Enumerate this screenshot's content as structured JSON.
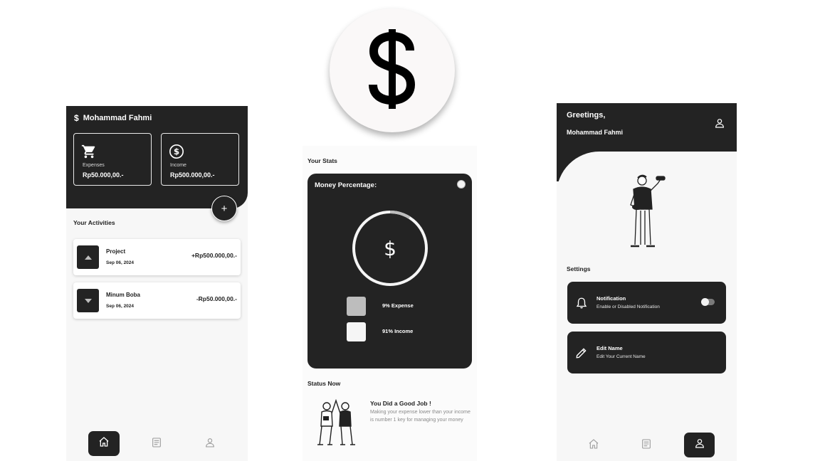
{
  "logo": {
    "icon": "dollar-icon",
    "symbol": "$"
  },
  "home": {
    "title": "Mohammad Fahmi",
    "cards": [
      {
        "icon": "cart-icon",
        "label": "Expenses",
        "value": "Rp50.000,00.-"
      },
      {
        "icon": "dollar-circle-icon",
        "label": "Income",
        "value": "Rp500.000,00.-"
      }
    ],
    "add_label": "+",
    "activities_heading": "Your Activities",
    "activities": [
      {
        "name": "Project",
        "date": "Sep 06, 2024",
        "amount": "+Rp500.000,00.-",
        "direction": "up"
      },
      {
        "name": "Minum Boba",
        "date": "Sep 06, 2024",
        "amount": "-Rp50.000,00.-",
        "direction": "down"
      }
    ],
    "nav": [
      "home",
      "list",
      "profile"
    ],
    "nav_active": "home"
  },
  "stats": {
    "heading": "Your Stats",
    "card_title": "Money Percentage:",
    "ring_symbol": "$",
    "expense_percent": 9,
    "legend": [
      {
        "label": "9% Expense",
        "color": "#bdbdbd"
      },
      {
        "label": "91% Income",
        "color": "#f5f5f5"
      }
    ],
    "status_heading": "Status Now",
    "status_title": "You Did a Good Job !",
    "status_text": "Making your expense lower than your income is number 1 key for managing your money"
  },
  "profile": {
    "greeting": "Greetings,",
    "name": "Mohammad Fahmi",
    "settings_heading": "Settings",
    "settings": [
      {
        "icon": "bell-icon",
        "title": "Notification",
        "subtitle": "Enable or Disabled Notification",
        "has_toggle": true,
        "toggle_on": false
      },
      {
        "icon": "pencil-icon",
        "title": "Edit Name",
        "subtitle": "Edit Your Current Name",
        "has_toggle": false
      }
    ],
    "nav": [
      "home",
      "list",
      "profile"
    ],
    "nav_active": "profile"
  },
  "colors": {
    "dark": "#232323",
    "light": "#f7f7f7",
    "accent_gray": "#bdbdbd"
  }
}
